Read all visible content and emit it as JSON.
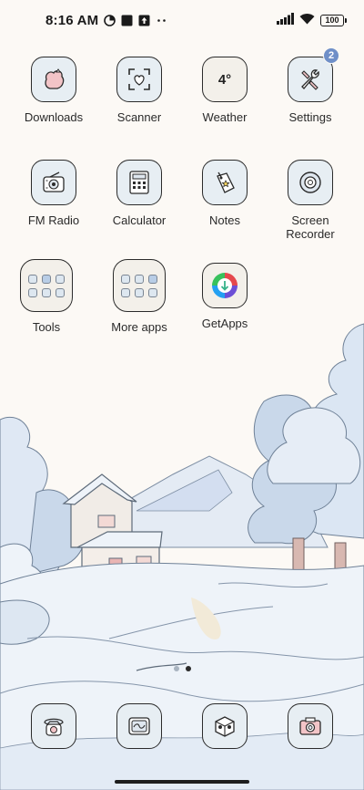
{
  "status_bar": {
    "time": "8:16 AM",
    "battery": "100"
  },
  "apps": [
    {
      "label": "Downloads",
      "icon": "downloads-icon"
    },
    {
      "label": "Scanner",
      "icon": "scanner-icon"
    },
    {
      "label": "Weather",
      "icon": "weather-icon",
      "icon_text": "4°"
    },
    {
      "label": "Settings",
      "icon": "settings-icon",
      "badge": "2"
    },
    {
      "label": "FM Radio",
      "icon": "radio-icon"
    },
    {
      "label": "Calculator",
      "icon": "calculator-icon"
    },
    {
      "label": "Notes",
      "icon": "notes-icon"
    },
    {
      "label": "Screen Recorder",
      "icon": "screen-recorder-icon"
    },
    {
      "label": "Tools",
      "icon": "tools-folder-icon"
    },
    {
      "label": "More apps",
      "icon": "more-apps-folder-icon"
    },
    {
      "label": "GetApps",
      "icon": "getapps-icon"
    }
  ],
  "page_indicator": {
    "count": 2,
    "active": 1
  },
  "dock": [
    {
      "icon": "phone-icon"
    },
    {
      "icon": "messages-icon"
    },
    {
      "icon": "browser-icon"
    },
    {
      "icon": "camera-icon"
    }
  ],
  "colors": {
    "background": "#fcf9f5",
    "icon_fill": "#e7eef3",
    "icon_stroke": "#2b2b2b",
    "badge": "#6f8fc8",
    "snow": "#eef3f9",
    "tree_blue": "#c9d8ea"
  }
}
